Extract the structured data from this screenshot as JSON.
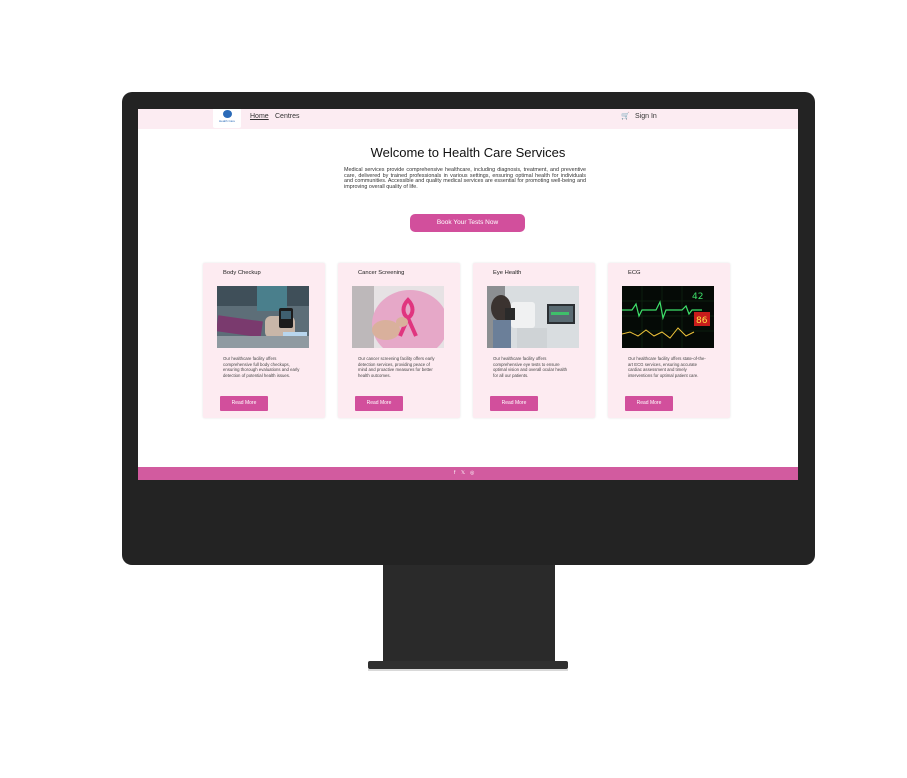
{
  "nav": {
    "logo_text": "Health Care",
    "links": [
      {
        "label": "Home"
      },
      {
        "label": "Centres"
      }
    ],
    "cart_icon": "cart-icon",
    "signin_label": "Sign In"
  },
  "hero": {
    "title": "Welcome to Health Care Services",
    "text": "Medical services provide comprehensive healthcare, including diagnosis, treatment, and preventive care, delivered by trained professionals in various settings, ensuring optimal health for individuals and communities. Accessible and quality medical services are essential for promoting well-being and improving overall quality of life.",
    "cta_label": "Book Your Tests Now"
  },
  "cards": [
    {
      "title": "Body Checkup",
      "image": "blood-pressure-checkup-photo",
      "text": "Our healthcare facility offers comprehensive full body checkups, ensuring thorough evaluations and early detection of potential health issues.",
      "button": "Read More"
    },
    {
      "title": "Cancer Screening",
      "image": "pink-ribbon-photo",
      "text": "Our cancer screening facility offers early detection services, providing peace of mind and proactive measures for better health outcomes.",
      "button": "Read More"
    },
    {
      "title": "Eye Health",
      "image": "eye-exam-photo",
      "text": "Our healthcare facility offers comprehensive eye tests to ensure optimal vision and overall ocular health for all our patients.",
      "button": "Read More"
    },
    {
      "title": "ECG",
      "image": "ecg-monitor-photo",
      "text": "Our healthcare facility offers state-of-the-art ECG services, ensuring accurate cardiac assessment and timely interventions for optimal patient care.",
      "button": "Read More"
    }
  ],
  "ecg_readout": {
    "top": "42",
    "mid": "86"
  },
  "footer": {
    "icons": [
      "f",
      "𝕏",
      "◎"
    ],
    "icon_names": [
      "facebook-icon",
      "x-icon",
      "instagram-icon"
    ]
  },
  "colors": {
    "accent": "#d24f9c",
    "nav_bg": "#fcecf2",
    "card_bg": "#fdebf1",
    "footer_bg": "#d25b9f"
  }
}
